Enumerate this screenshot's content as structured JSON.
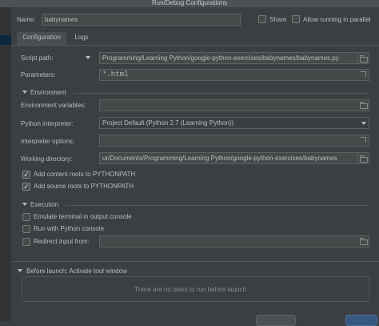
{
  "window": {
    "title": "Run/Debug Configurations"
  },
  "name_row": {
    "label": "Name:",
    "value": "babynames",
    "share_label": "Share",
    "parallel_label": "Allow running in parallel"
  },
  "tabs": [
    {
      "label": "Configuration",
      "active": true
    },
    {
      "label": "Logs",
      "active": false
    }
  ],
  "config": {
    "script_path": {
      "label": "Script path:",
      "value": "Programming/Learning Python/google-python-exercises/babynames/babynames.py"
    },
    "parameters": {
      "label": "Parameters:",
      "value": "*.html"
    }
  },
  "environment": {
    "section_label": "Environment",
    "env_vars": {
      "label": "Environment variables:",
      "value": ""
    },
    "interpreter": {
      "label": "Python interpreter:",
      "value": "Project Default (Python 2.7 (Learning Python))"
    },
    "interp_options": {
      "label": "Interpreter options:",
      "value": ""
    },
    "working_dir": {
      "label": "Working directory:",
      "value": "ur/Documents/Programming/Learning Python/google-python-exercises/babynames"
    },
    "add_content_roots": {
      "label": "Add content roots to PYTHONPATH",
      "checked": true
    },
    "add_source_roots": {
      "label": "Add source roots to PYTHONPATH",
      "checked": true
    }
  },
  "execution": {
    "section_label": "Execution",
    "emulate_terminal": {
      "label": "Emulate terminal in output console",
      "checked": false
    },
    "python_console": {
      "label": "Run with Python console",
      "checked": false
    },
    "redirect_input": {
      "label": "Redirect input from:",
      "checked": false,
      "value": ""
    }
  },
  "before_launch": {
    "label": "Before launch: Activate tool window",
    "empty_text": "There are no tasks to run before launch"
  },
  "icons": {
    "folder": "folder-icon",
    "expand": "expand-icon",
    "dropdown": "chevron-down-icon",
    "collapse": "triangle-down-icon",
    "check": "check-icon"
  },
  "colors": {
    "background": "#3c3f41",
    "field": "#45494a",
    "text": "#bbbbbb",
    "primary_button": "#365880"
  }
}
